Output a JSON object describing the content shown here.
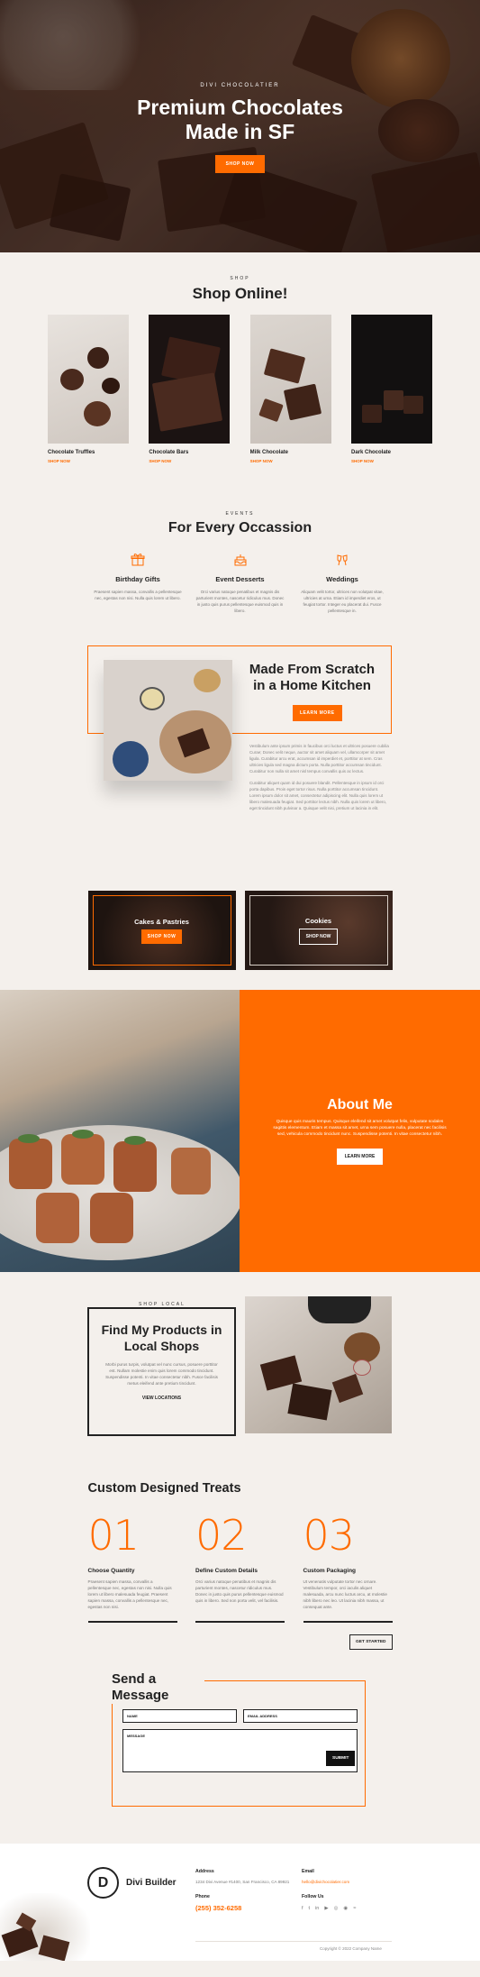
{
  "hero": {
    "kicker": "DIVI CHOCOLATIER",
    "title_line1": "Premium Chocolates",
    "title_line2": "Made in SF",
    "button": "SHOP NOW"
  },
  "shop": {
    "kicker": "SHOP",
    "title": "Shop Online!",
    "products": [
      {
        "name": "Chocolate Truffles",
        "link": "SHOP NOW"
      },
      {
        "name": "Chocolate Bars",
        "link": "SHOP NOW"
      },
      {
        "name": "Milk Chocolate",
        "link": "SHOP NOW"
      },
      {
        "name": "Dark Chocolate",
        "link": "SHOP NOW"
      }
    ]
  },
  "occasion": {
    "kicker": "EVENTS",
    "title": "For Every Occassion",
    "items": [
      {
        "icon": "gift-icon",
        "title": "Birthday Gifts",
        "text": "Praesent sapien massa, convallis a pellentesque nec, egestas non nisi. Nulla quis lorem ut libero."
      },
      {
        "icon": "cake-icon",
        "title": "Event Desserts",
        "text": "Orci varius natoque penatibus et magnis dis parturient montes, nascetur ridiculus mus. Donec in justo quis purus pellentesque euismod quis in libero."
      },
      {
        "icon": "cheers-icon",
        "title": "Weddings",
        "text": "Aliquam velit tortor, ultrices non volutpat vitae, ultricies at urna. Etiam id imperdiet eros, ut feugiat tortor. Integer eu placerat dui. Fusce pellentesque in."
      }
    ]
  },
  "scratch": {
    "title_line1": "Made From Scratch",
    "title_line2": "in a Home Kitchen",
    "button": "LEARN MORE",
    "para1": "Vestibulum ante ipsum primis in faucibus orci luctus et ultrices posuere cubilia Curae; Donec velit neque, auctor sit amet aliquam vel, ullamcorper sit amet ligula. Curabitur arcu erat, accumsan id imperdiet et, porttitor at sem. Cras ultricies ligula sed magna dictum porta. Nulla porttitor accumsan tincidunt. Curabitur non nulla sit amet nisl tempus convallis quis ac lectus.",
    "para2": "Curabitur aliquet quam id dui posuere blandit. Pellentesque in ipsum id orci porta dapibus. Proin eget tortor risus. Nulla porttitor accumsan tincidunt. Lorem ipsum dolor sit amet, consectetur adipiscing elit. Nulla quis lorem ut libero malesuada feugiat. Sed porttitor lectus nibh. Nulla quis lorem ut libero, eget tincidunt nibh pulvinar a. Quisque velit nisi, pretium ut lacinia in elit."
  },
  "cards": [
    {
      "title": "Cakes & Pastries",
      "button": "SHOP NOW"
    },
    {
      "title": "Cookies",
      "button": "SHOP NOW"
    }
  ],
  "about": {
    "title": "About Me",
    "text": "Quisque quis mauris tempus. Quisque eleifend sit amet volutpat felis, vulputate sodales sagittis elementum. Etiam et massa sit amet, urna sem posuere nulla, placerat nec facilisis sed, vehicula commodo tincidunt nunc. Suspendisse potenti. In vitae consectetur nibh.",
    "button": "LEARN MORE"
  },
  "local": {
    "kicker": "SHOP LOCAL",
    "title_line1": "Find My Products in",
    "title_line2": "Local Shops",
    "text": "Morbi purus turpis, volutpat vel nunc cursus, posuere porttitor est. Nullam molestie enim quis lorem commodo tincidunt. Suspendisse potenti. In vitae consectetur nibh. Fusce facilisis metus eleifend ante pretium tincidunt.",
    "link": "VIEW LOCATIONS"
  },
  "treats": {
    "title": "Custom Designed Treats",
    "steps": [
      {
        "num": "01",
        "title": "Choose Quantity",
        "text": "Praesent sapien massa, convallis a pellentesque nec, egestas non nisi. Nulla quis lorem ut libero malesuada feugiat. Praesent sapien massa, convallis a pellentesque nec, egestas non nisi."
      },
      {
        "num": "02",
        "title": "Define Custom Details",
        "text": "Orci varius natoque penatibus et magnis dis parturient montes, nascetur ridiculus mus. Donec in justo quis purus pellentesque euismod quis in libero. Sed non porta velit, vel facilisis."
      },
      {
        "num": "03",
        "title": "Custom Packaging",
        "text": "Ut venenatis vulputate tortor nec ornare. Vestibulum tempor, orci iaculis aliquet malesuada, arcu nunc luctus arcu, at molestie nibh libero nec leo. Ut lacinia nibh massa, ut consequat ante."
      }
    ],
    "button": "GET STARTED"
  },
  "message": {
    "title_line1": "Send a",
    "title_line2": "Message",
    "name_placeholder": "NAME",
    "email_placeholder": "EMAIL ADDRESS",
    "message_placeholder": "MESSAGE",
    "submit": "SUBMIT"
  },
  "footer": {
    "logo_letter": "D",
    "brand": "Divi Builder",
    "address_label": "Address",
    "address": "1234 Divi Avenue #1400, San Francisco, CA 89921",
    "phone_label": "Phone",
    "phone": "(255) 352-6258",
    "email_label": "Email",
    "email": "hello@divichocolatier.com",
    "follow_label": "Follow Us",
    "social": [
      "f",
      "t",
      "in",
      "▶",
      "◎",
      "◉",
      "≈"
    ],
    "copyright": "Copyright © 2022 Company Name"
  },
  "colors": {
    "accent": "#ff6b00",
    "background": "#f4f0ec",
    "dark": "#222222"
  }
}
